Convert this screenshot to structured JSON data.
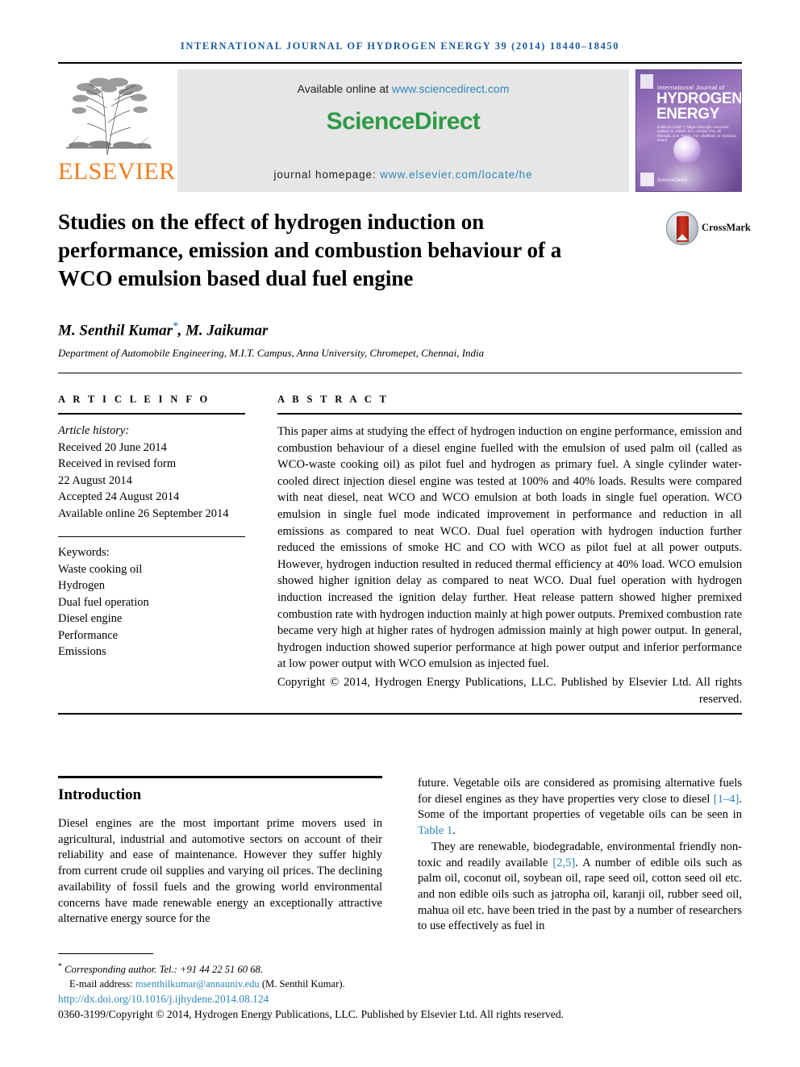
{
  "running_head": "International Journal of Hydrogen Energy 39 (2014) 18440–18450",
  "masthead": {
    "publisher": "ELSEVIER",
    "available_prefix": "Available online at ",
    "available_url": "www.sciencedirect.com",
    "sciencedirect_logo": "ScienceDirect",
    "homepage_prefix": "journal homepage: ",
    "homepage_url": "www.elsevier.com/locate/he",
    "cover": {
      "small_title": "International Journal of",
      "big_title": "HYDROGEN ENERGY",
      "meta": "Editor-in-Chief: T. Nejat Veziroğlu  Associate Editors: D. Hissel, D.C. Jordan, P.E. de Miranda, B.G. Pollet, J.W. Sheffield, Sr. Editorial Board",
      "sciencedirect_mark": "ScienceDirect"
    }
  },
  "article": {
    "title": "Studies on the effect of hydrogen induction on performance, emission and combustion behaviour of a WCO emulsion based dual fuel engine",
    "crossmark_label": "CrossMark",
    "authors": "M. Senthil Kumar",
    "authors_rest": ", M. Jaikumar",
    "corresponding_marker": "*",
    "affiliation": "Department of Automobile Engineering, M.I.T. Campus, Anna University, Chromepet, Chennai, India"
  },
  "article_info": {
    "heading": "A R T I C L E  I N F O",
    "history_label": "Article history:",
    "history": [
      "Received 20 June 2014",
      "Received in revised form",
      "22 August 2014",
      "Accepted 24 August 2014",
      "Available online 26 September 2014"
    ],
    "keywords_label": "Keywords:",
    "keywords": [
      "Waste cooking oil",
      "Hydrogen",
      "Dual fuel operation",
      "Diesel engine",
      "Performance",
      "Emissions"
    ]
  },
  "abstract": {
    "heading": "A B S T R A C T",
    "text": "This paper aims at studying the effect of hydrogen induction on engine performance, emission and combustion behaviour of a diesel engine fuelled with the emulsion of used palm oil (called as WCO-waste cooking oil) as pilot fuel and hydrogen as primary fuel. A single cylinder water-cooled direct injection diesel engine was tested at 100% and 40% loads. Results were compared with neat diesel, neat WCO and WCO emulsion at both loads in single fuel operation. WCO emulsion in single fuel mode indicated improvement in performance and reduction in all emissions as compared to neat WCO. Dual fuel operation with hydrogen induction further reduced the emissions of smoke HC and CO with WCO as pilot fuel at all power outputs. However, hydrogen induction resulted in reduced thermal efficiency at 40% load. WCO emulsion showed higher ignition delay as compared to neat WCO. Dual fuel operation with hydrogen induction increased the ignition delay further. Heat release pattern showed higher premixed combustion rate with hydrogen induction mainly at high power outputs. Premixed combustion rate became very high at higher rates of hydrogen admission mainly at high power output. In general, hydrogen induction showed superior performance at high power output and inferior performance at low power output with WCO emulsion as injected fuel.",
    "copyright": "Copyright © 2014, Hydrogen Energy Publications, LLC. Published by Elsevier Ltd. All rights reserved."
  },
  "introduction": {
    "heading": "Introduction",
    "left_paragraph": "Diesel engines are the most important prime movers used in agricultural, industrial and automotive sectors on account of their reliability and ease of maintenance. However they suffer highly from current crude oil supplies and varying oil prices. The declining availability of fossil fuels and the growing world environmental concerns have made renewable energy an exceptionally attractive alternative energy source for the",
    "right_p1_a": "future. Vegetable oils are considered as promising alternative fuels for diesel engines as they have properties very close to diesel ",
    "right_p1_ref1": "[1–4]",
    "right_p1_b": ". Some of the important properties of vegetable oils can be seen in ",
    "right_p1_table": "Table 1",
    "right_p1_c": ".",
    "right_p2_a": "They are renewable, biodegradable, environmental friendly non-toxic and readily available ",
    "right_p2_ref": "[2,5]",
    "right_p2_b": ". A number of edible oils such as palm oil, coconut oil, soybean oil, rape seed oil, cotton seed oil etc. and non edible oils such as jatropha oil, karanji oil, rubber seed oil, mahua oil etc. have been tried in the past by a number of researchers to use effectively as fuel in"
  },
  "footer": {
    "corresponding": "Corresponding author. Tel.: +91 44 22 51 60 68.",
    "email_label": "E-mail address: ",
    "email": "msenthilkumar@annauniv.edu",
    "email_suffix": " (M. Senthil Kumar).",
    "doi": "http://dx.doi.org/10.1016/j.ijhydene.2014.08.124",
    "issn_line": "0360-3199/Copyright © 2014, Hydrogen Energy Publications, LLC. Published by Elsevier Ltd. All rights reserved."
  },
  "colors": {
    "journal_blue": "#1a5a9e",
    "link_blue": "#2e87ba",
    "elsevier_orange": "#F07C1E",
    "sciencedirect_green": "#2f9a46"
  }
}
